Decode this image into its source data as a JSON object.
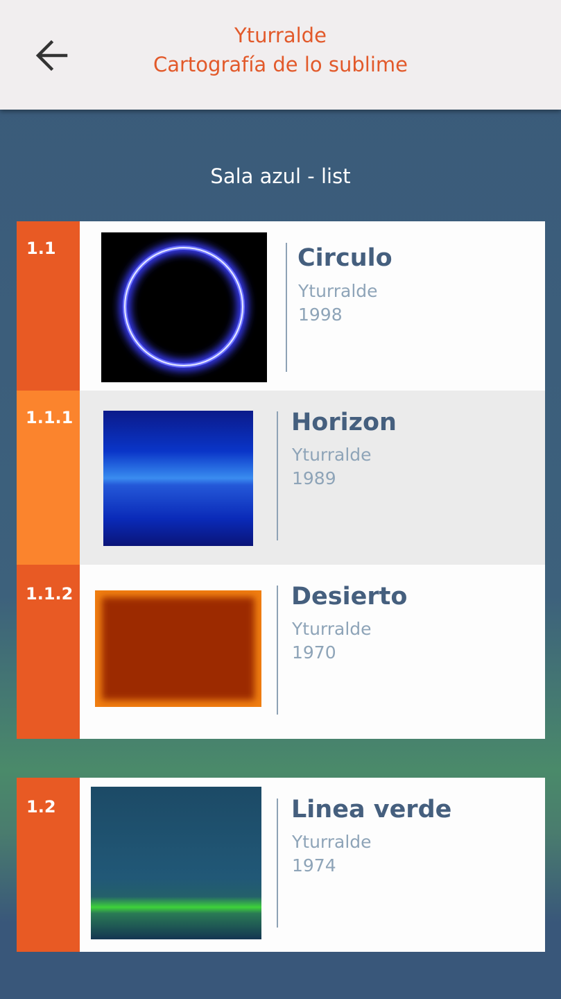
{
  "header": {
    "title_line1": "Yturralde",
    "title_line2": "Cartografía de lo sublime",
    "back_icon": "arrow-left-icon",
    "title_color": "#e2592a",
    "background": "#f1eeef"
  },
  "section": {
    "title": "Sala azul - list"
  },
  "items": [
    {
      "number": "1.1",
      "title": "Circulo",
      "artist": "Yturralde",
      "year": "1998",
      "number_bg": "#e85a24",
      "artwork": "blue-ring-artwork"
    },
    {
      "number": "1.1.1",
      "title": "Horizon",
      "artist": "Yturralde",
      "year": "1989",
      "number_bg": "#fb842d",
      "selected": true,
      "artwork": "blue-horizon-artwork"
    },
    {
      "number": "1.1.2",
      "title": "Desierto",
      "artist": "Yturralde",
      "year": "1970",
      "number_bg": "#e85a24",
      "artwork": "orange-desert-artwork"
    },
    {
      "number": "1.2",
      "title": "Linea verde",
      "artist": "Yturralde",
      "year": "1974",
      "number_bg": "#e85a24",
      "artwork": "green-line-artwork"
    }
  ],
  "colors": {
    "accent": "#e85a24",
    "accent_light": "#fb842d",
    "title_text": "#455f7e",
    "meta_text": "#8ea4b8"
  }
}
